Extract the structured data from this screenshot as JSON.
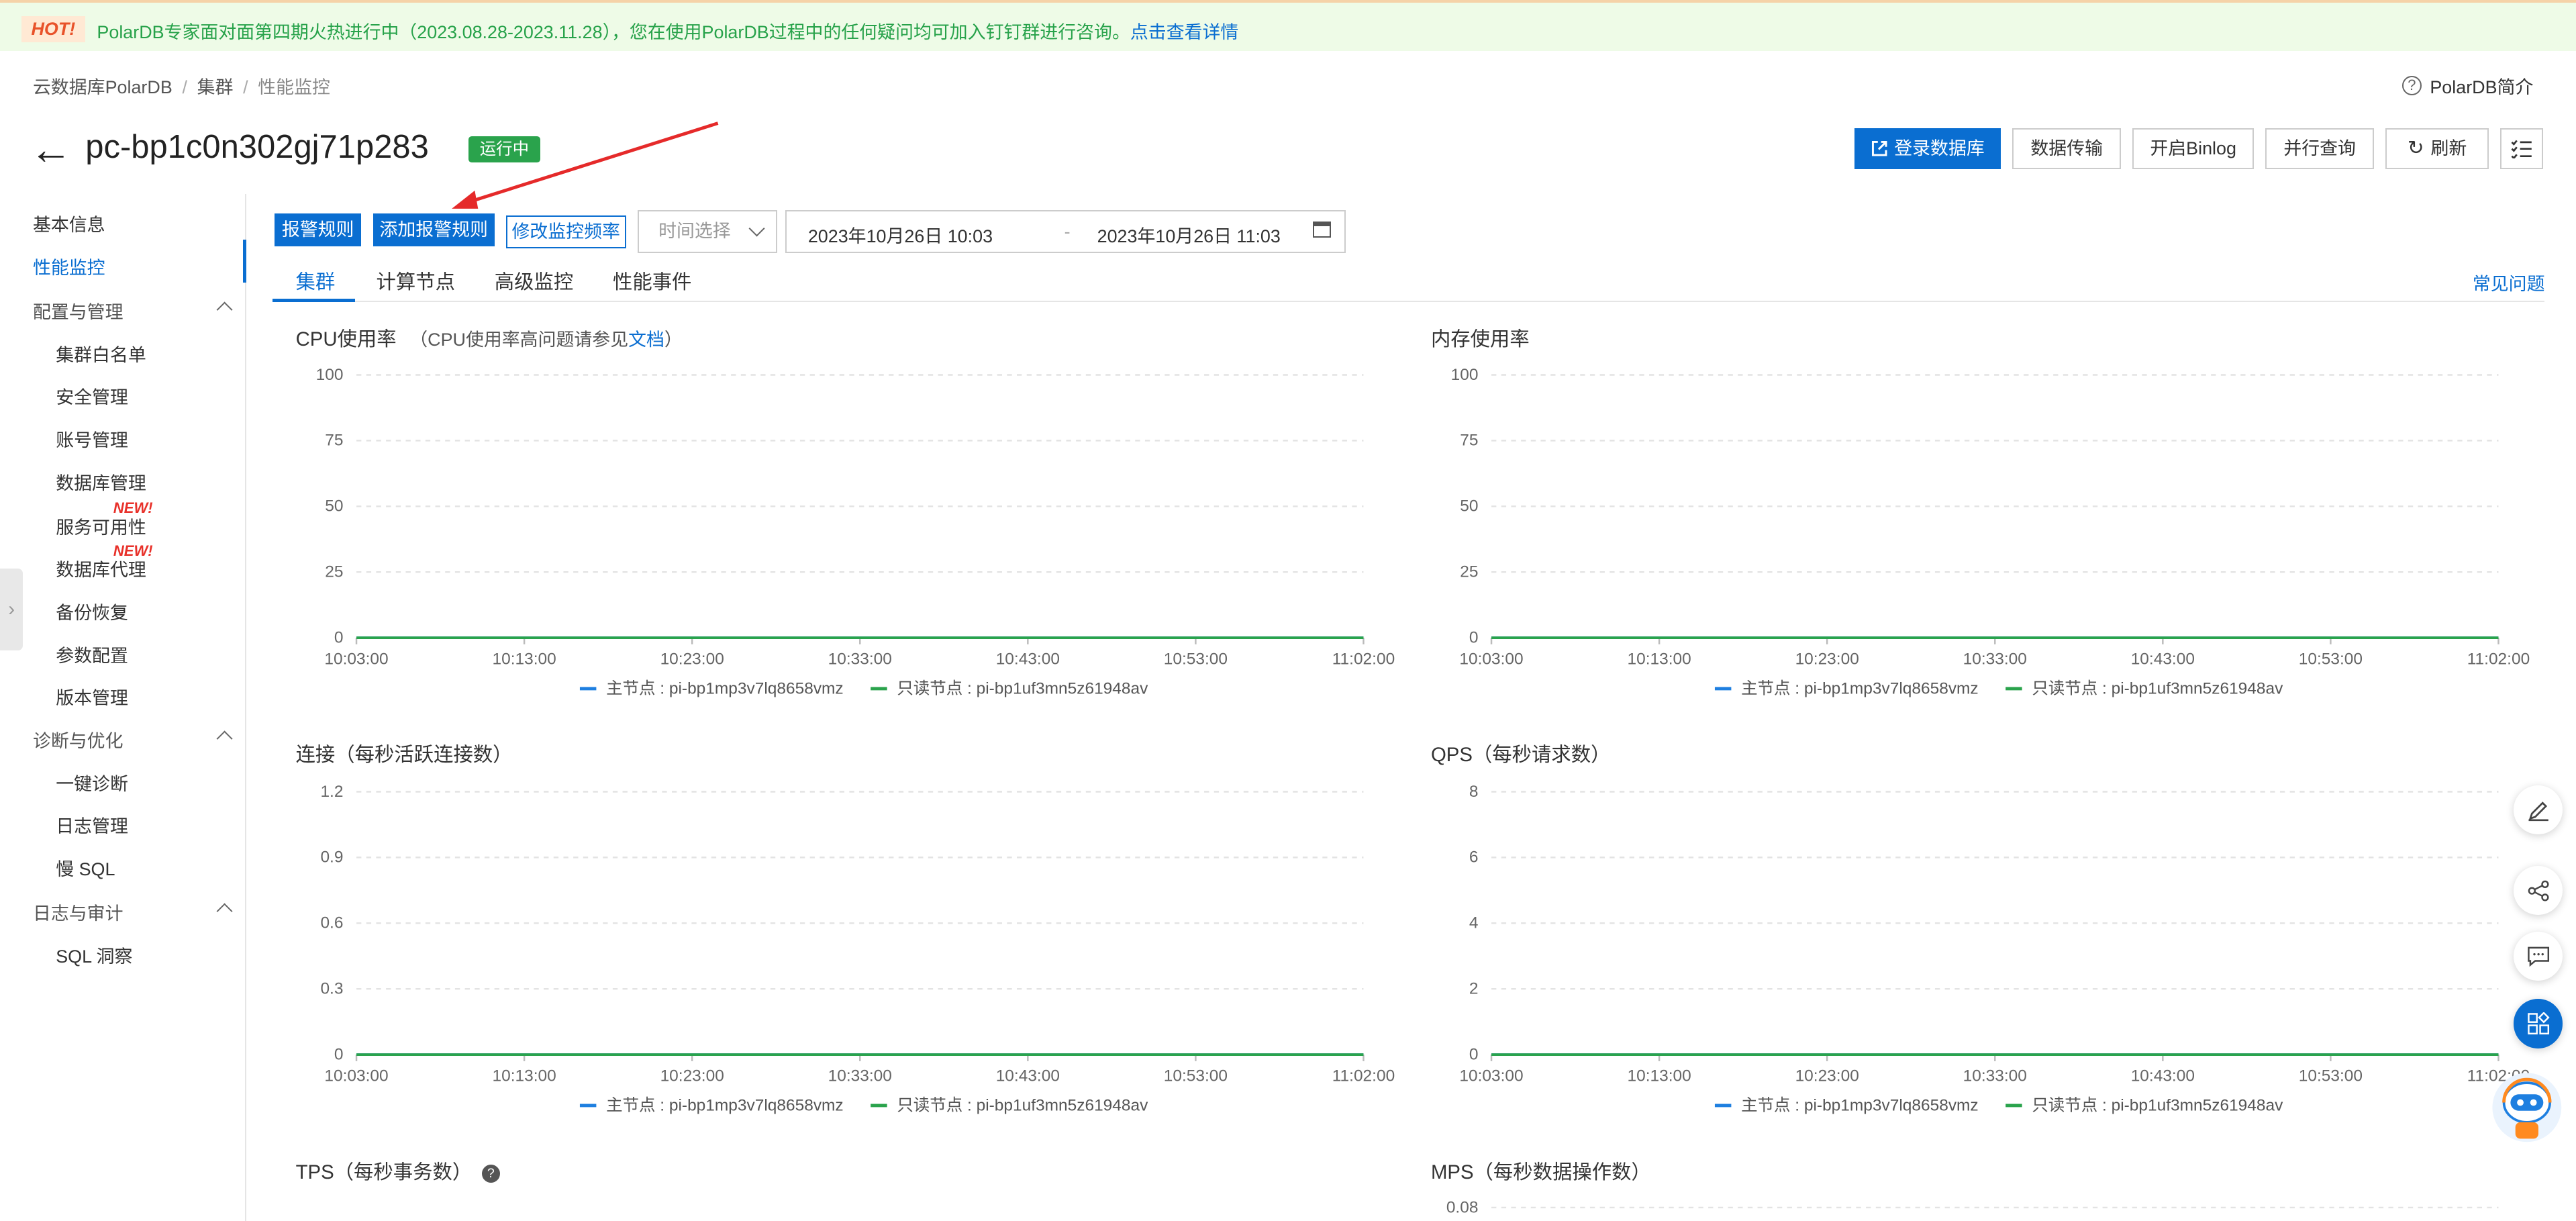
{
  "banner": {
    "hot": "HOT!",
    "text": "PolarDB专家面对面第四期火热进行中（2023.08.28-2023.11.28），您在使用PolarDB过程中的任何疑问均可加入钉钉群进行咨询。",
    "link": "点击查看详情"
  },
  "breadcrumb": [
    "云数据库PolarDB",
    "集群",
    "性能监控"
  ],
  "intro_link": "PolarDB简介",
  "header": {
    "title": "pc-bp1c0n302gj71p283",
    "status": "运行中",
    "buttons": [
      "登录数据库",
      "数据传输",
      "开启Binlog",
      "并行查询",
      "刷新"
    ]
  },
  "sidebar": {
    "top_items": [
      "基本信息",
      "性能监控"
    ],
    "groups": [
      {
        "label": "配置与管理",
        "items": [
          "集群白名单",
          "安全管理",
          "账号管理",
          "数据库管理",
          "服务可用性",
          "数据库代理",
          "备份恢复",
          "参数配置",
          "版本管理"
        ]
      },
      {
        "label": "诊断与优化",
        "items": [
          "一键诊断",
          "日志管理",
          "慢 SQL"
        ]
      },
      {
        "label": "日志与审计",
        "items": [
          "SQL 洞察"
        ]
      }
    ],
    "new_badge": "NEW!"
  },
  "toolbar": {
    "alarm_rules": "报警规则",
    "add_alarm_rule": "添加报警规则",
    "modify_frequency": "修改监控频率",
    "time_select_placeholder": "时间选择",
    "start_time": "2023年10月26日 10:03",
    "range_sep": "-",
    "end_time": "2023年10月26日 11:03"
  },
  "tabs": [
    "集群",
    "计算节点",
    "高级监控",
    "性能事件"
  ],
  "faq": "常见问题",
  "colors": {
    "primary": "#0a6ed1",
    "main_node": "#1e7fe0",
    "readonly_node": "#2aa34c",
    "hot": "#e8522a"
  },
  "legend": {
    "main": "主节点 : pi-bp1mp3v7lq8658vmz",
    "readonly": "只读节点 : pi-bp1uf3mn5z61948av"
  },
  "chart_data": [
    {
      "type": "line",
      "title": "CPU使用率",
      "subtitle_prefix": "（CPU使用率高问题请参见",
      "subtitle_link": "文档",
      "subtitle_suffix": "）",
      "yticks": [
        "0",
        "25",
        "50",
        "75",
        "100"
      ],
      "x": [
        "10:03:00",
        "10:13:00",
        "10:23:00",
        "10:33:00",
        "10:43:00",
        "10:53:00",
        "11:02:00"
      ],
      "series": [
        {
          "name": "主节点 : pi-bp1mp3v7lq8658vmz",
          "values": [
            0,
            0,
            0,
            0,
            0,
            0,
            0
          ]
        },
        {
          "name": "只读节点 : pi-bp1uf3mn5z61948av",
          "values": [
            0,
            0,
            0,
            0,
            0,
            0,
            0
          ]
        }
      ],
      "ylim": [
        0,
        100
      ]
    },
    {
      "type": "line",
      "title": "内存使用率",
      "yticks": [
        "0",
        "25",
        "50",
        "75",
        "100"
      ],
      "x": [
        "10:03:00",
        "10:13:00",
        "10:23:00",
        "10:33:00",
        "10:43:00",
        "10:53:00",
        "11:02:00"
      ],
      "series": [
        {
          "name": "主节点 : pi-bp1mp3v7lq8658vmz",
          "values": [
            0,
            0,
            0,
            0,
            0,
            0,
            0
          ]
        },
        {
          "name": "只读节点 : pi-bp1uf3mn5z61948av",
          "values": [
            0,
            0,
            0,
            0,
            0,
            0,
            0
          ]
        }
      ],
      "ylim": [
        0,
        100
      ]
    },
    {
      "type": "line",
      "title": "连接（每秒活跃连接数）",
      "yticks": [
        "0",
        "0.3",
        "0.6",
        "0.9",
        "1.2"
      ],
      "x": [
        "10:03:00",
        "10:13:00",
        "10:23:00",
        "10:33:00",
        "10:43:00",
        "10:53:00",
        "11:02:00"
      ],
      "series": [
        {
          "name": "主节点 : pi-bp1mp3v7lq8658vmz",
          "values": [
            0,
            0,
            0,
            0,
            0,
            0,
            0
          ]
        },
        {
          "name": "只读节点 : pi-bp1uf3mn5z61948av",
          "values": [
            0,
            0,
            0,
            0,
            0,
            0,
            0
          ]
        }
      ],
      "ylim": [
        0,
        1.2
      ]
    },
    {
      "type": "line",
      "title": "QPS（每秒请求数）",
      "yticks": [
        "0",
        "2",
        "4",
        "6",
        "8"
      ],
      "x": [
        "10:03:00",
        "10:13:00",
        "10:23:00",
        "10:33:00",
        "10:43:00",
        "10:53:00",
        "11:02:00"
      ],
      "series": [
        {
          "name": "主节点 : pi-bp1mp3v7lq8658vmz",
          "values": [
            0,
            0,
            0,
            0,
            0,
            0,
            0
          ]
        },
        {
          "name": "只读节点 : pi-bp1uf3mn5z61948av",
          "values": [
            0,
            0,
            0,
            0,
            0,
            0,
            0
          ]
        }
      ],
      "ylim": [
        0,
        8
      ]
    },
    {
      "type": "line",
      "title": "TPS（每秒事务数）",
      "yticks": [],
      "x": [],
      "series": []
    },
    {
      "type": "line",
      "title": "MPS（每秒数据操作数）",
      "yticks": [
        "0.08"
      ],
      "x": [],
      "series": []
    }
  ]
}
